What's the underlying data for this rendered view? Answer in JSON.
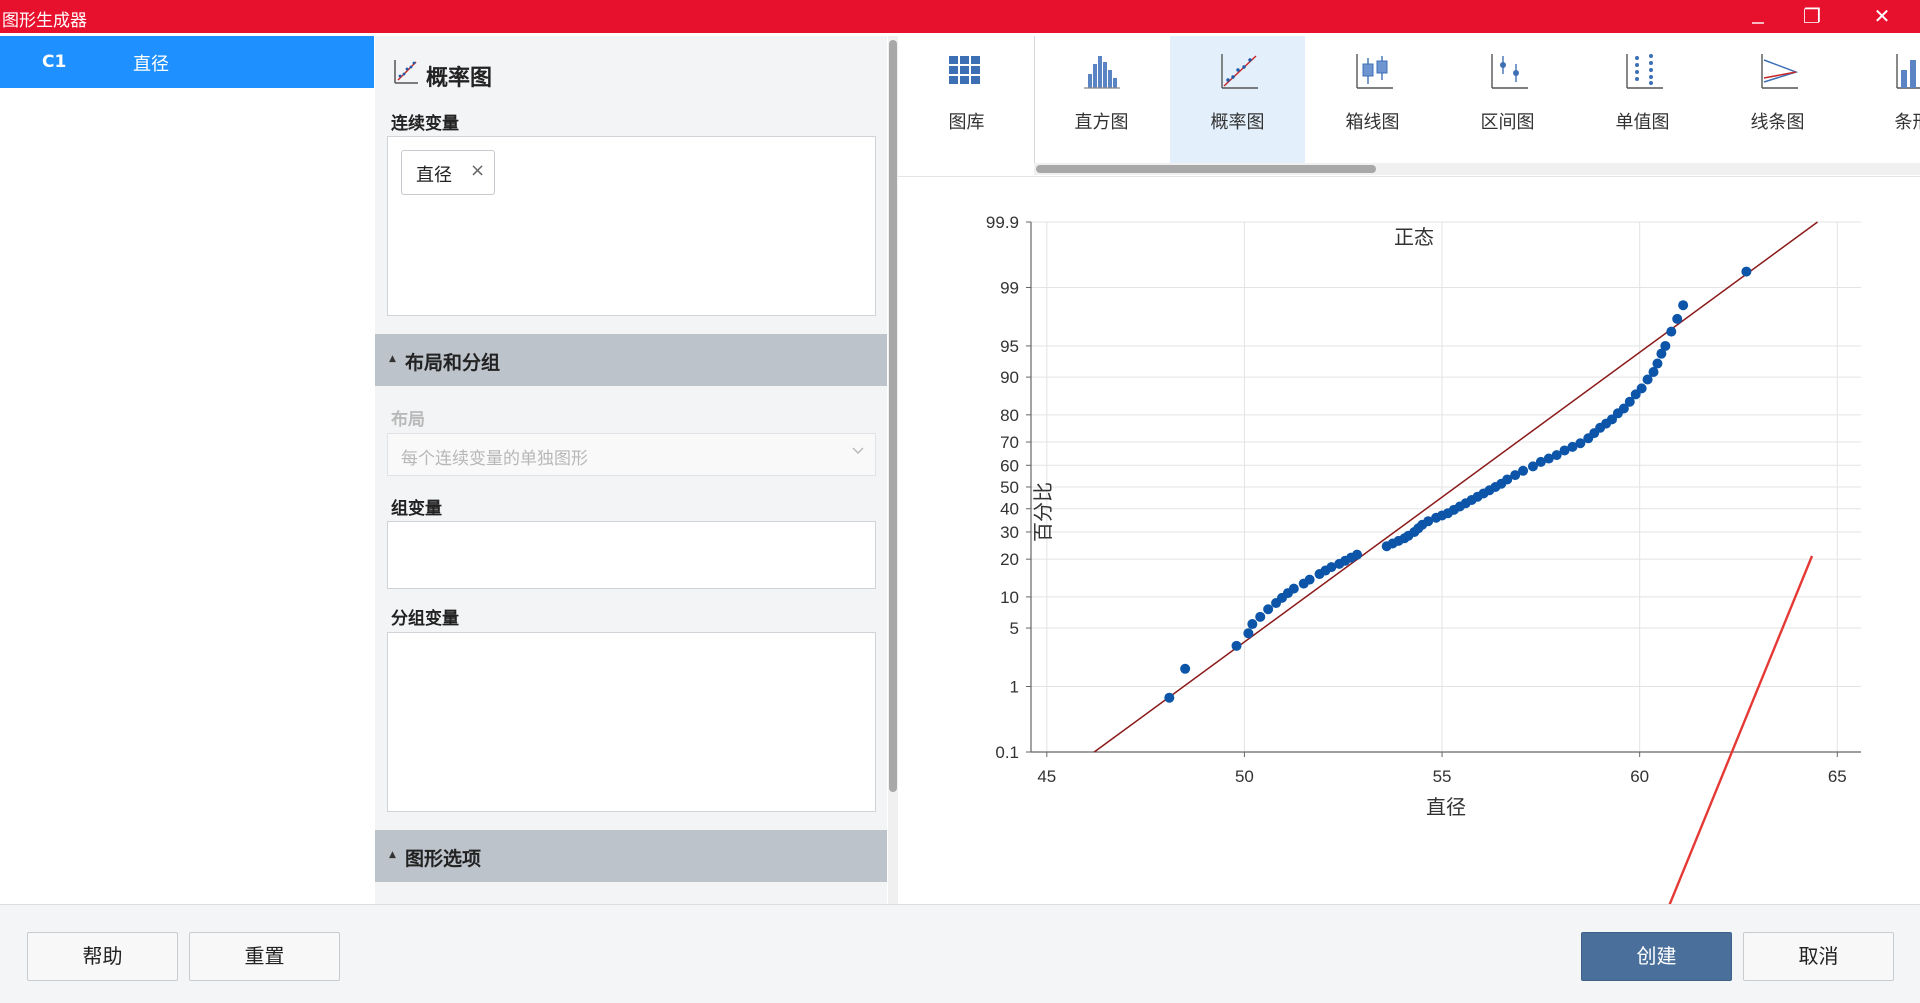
{
  "window": {
    "title": "图形生成器",
    "restore_glyph": "❐",
    "close_glyph": "✕"
  },
  "columns": [
    {
      "id": "C1",
      "name": "直径"
    }
  ],
  "panel": {
    "section_title": "概率图",
    "continuous_label": "连续变量",
    "chip_text": "直径",
    "chip_remove_glyph": "×",
    "layout_group": "布局和分组",
    "layout_label": "布局",
    "layout_value": "每个连续变量的单独图形",
    "group_var_label": "组变量",
    "split_var_label": "分组变量",
    "graph_options_group": "图形选项"
  },
  "gallery": [
    {
      "label": "图库",
      "icon": "grid-icon"
    },
    {
      "label": "直方图",
      "icon": "histogram-icon"
    },
    {
      "label": "概率图",
      "icon": "probability-plot-icon",
      "selected": true
    },
    {
      "label": "箱线图",
      "icon": "boxplot-icon"
    },
    {
      "label": "区间图",
      "icon": "interval-plot-icon"
    },
    {
      "label": "单值图",
      "icon": "individual-value-plot-icon"
    },
    {
      "label": "线条图",
      "icon": "line-plot-icon"
    },
    {
      "label": "条形",
      "icon": "bar-chart-icon"
    }
  ],
  "chart_data": {
    "type": "scatter",
    "title": "正态",
    "xlabel": "直径",
    "ylabel": "百分比",
    "xlim": [
      44.6,
      65.6
    ],
    "x_ticks": [
      45,
      50,
      55,
      60,
      65
    ],
    "y_scale": "normal-probability",
    "y_ticks": [
      0.1,
      1,
      5,
      10,
      20,
      30,
      40,
      50,
      60,
      70,
      80,
      90,
      95,
      99,
      99.9
    ],
    "grid": true,
    "fit_line": {
      "x": [
        46.2,
        64.5
      ],
      "y": [
        0.1,
        99.9
      ]
    },
    "series": [
      {
        "points": [
          [
            48.1,
            0.7
          ],
          [
            48.5,
            1.7
          ],
          [
            49.8,
            3.2
          ],
          [
            50.1,
            4.4
          ],
          [
            50.2,
            5.5
          ],
          [
            50.4,
            6.5
          ],
          [
            50.6,
            7.7
          ],
          [
            50.8,
            8.8
          ],
          [
            50.95,
            9.8
          ],
          [
            51.1,
            10.8
          ],
          [
            51.25,
            11.8
          ],
          [
            51.5,
            13.0
          ],
          [
            51.65,
            14.0
          ],
          [
            51.9,
            15.5
          ],
          [
            52.05,
            16.5
          ],
          [
            52.2,
            17.5
          ],
          [
            52.4,
            18.5
          ],
          [
            52.55,
            19.5
          ],
          [
            52.7,
            20.5
          ],
          [
            52.85,
            21.5
          ],
          [
            53.6,
            24.5
          ],
          [
            53.75,
            25.5
          ],
          [
            53.9,
            26.5
          ],
          [
            54.05,
            27.5
          ],
          [
            54.15,
            28.5
          ],
          [
            54.3,
            30.0
          ],
          [
            54.4,
            31.5
          ],
          [
            54.5,
            33.0
          ],
          [
            54.65,
            34.5
          ],
          [
            54.85,
            36.0
          ],
          [
            55.0,
            37.0
          ],
          [
            55.15,
            38.0
          ],
          [
            55.3,
            39.5
          ],
          [
            55.45,
            41.0
          ],
          [
            55.6,
            42.5
          ],
          [
            55.75,
            44.0
          ],
          [
            55.9,
            45.5
          ],
          [
            56.05,
            47.0
          ],
          [
            56.2,
            48.5
          ],
          [
            56.35,
            50.0
          ],
          [
            56.5,
            51.5
          ],
          [
            56.65,
            53.5
          ],
          [
            56.85,
            55.5
          ],
          [
            57.05,
            57.5
          ],
          [
            57.3,
            59.5
          ],
          [
            57.5,
            61.5
          ],
          [
            57.7,
            63.0
          ],
          [
            57.9,
            64.5
          ],
          [
            58.1,
            66.5
          ],
          [
            58.3,
            68.0
          ],
          [
            58.5,
            69.5
          ],
          [
            58.7,
            71.5
          ],
          [
            58.85,
            73.5
          ],
          [
            59.0,
            75.5
          ],
          [
            59.15,
            77.0
          ],
          [
            59.3,
            78.5
          ],
          [
            59.45,
            80.5
          ],
          [
            59.6,
            82.0
          ],
          [
            59.75,
            84.0
          ],
          [
            59.9,
            86.0
          ],
          [
            60.05,
            87.5
          ],
          [
            60.2,
            89.5
          ],
          [
            60.35,
            91.0
          ],
          [
            60.45,
            92.5
          ],
          [
            60.55,
            94.0
          ],
          [
            60.65,
            95.0
          ],
          [
            60.8,
            96.5
          ],
          [
            60.95,
            97.5
          ],
          [
            61.1,
            98.3
          ],
          [
            62.7,
            99.4
          ]
        ]
      }
    ]
  },
  "buttons": {
    "help": "帮助",
    "reset": "重置",
    "create": "创建",
    "cancel": "取消"
  },
  "colors": {
    "titlebar": "#e8112d",
    "selected_row": "#1e90ff",
    "points": "#0c55a8",
    "fit_line": "#8b1a1a",
    "primary": "#4a6f9b"
  }
}
